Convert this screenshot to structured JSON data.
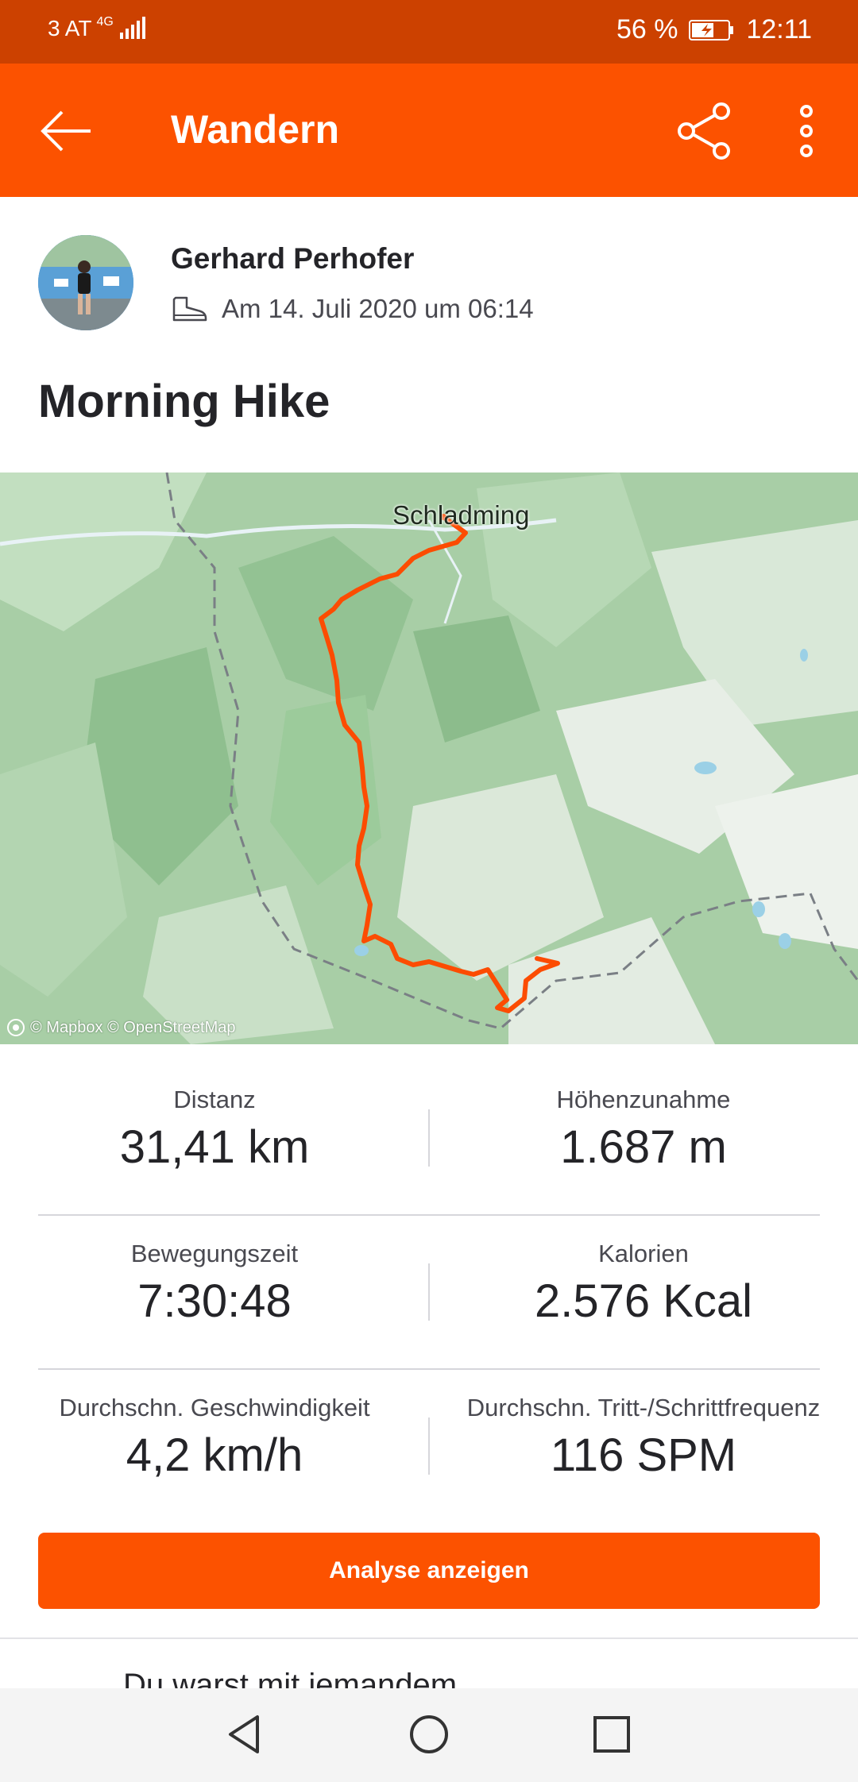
{
  "status_bar": {
    "carrier": "3 AT",
    "network": "4G",
    "battery": "56 %",
    "time": "12:11"
  },
  "app_bar": {
    "title": "Wandern",
    "icons": [
      "arrow-left-icon",
      "share-icon",
      "more-vertical-icon"
    ]
  },
  "header": {
    "athlete_name": "Gerhard Perhofer",
    "activity_icon": "hiking-boot-icon",
    "date_text": "Am 14. Juli 2020 um 06:14"
  },
  "activity": {
    "title": "Morning Hike"
  },
  "map": {
    "place_label": "Schladming",
    "attribution": "© Mapbox © OpenStreetMap",
    "route_color": "#fc4c02"
  },
  "stats": [
    {
      "label": "Distanz",
      "value": "31,41 km"
    },
    {
      "label": "Höhenzunahme",
      "value": "1.687 m"
    },
    {
      "label": "Bewegungszeit",
      "value": "7:30:48"
    },
    {
      "label": "Kalorien",
      "value": "2.576 Kcal"
    },
    {
      "label": "Durchschn. Geschwindigkeit",
      "value": "4,2 km/h"
    },
    {
      "label": "Durchschn. Tritt-/Schrittfrequenz",
      "value": "116 SPM"
    }
  ],
  "cta": {
    "label": "Analyse anzeigen"
  },
  "teaser": {
    "text": "Du warst mit jemandem"
  },
  "nav_bar": {
    "icons": [
      "nav-back-icon",
      "nav-home-icon",
      "nav-recents-icon"
    ]
  },
  "colors": {
    "brand": "#fc5200",
    "status_bar": "#cc4100"
  }
}
